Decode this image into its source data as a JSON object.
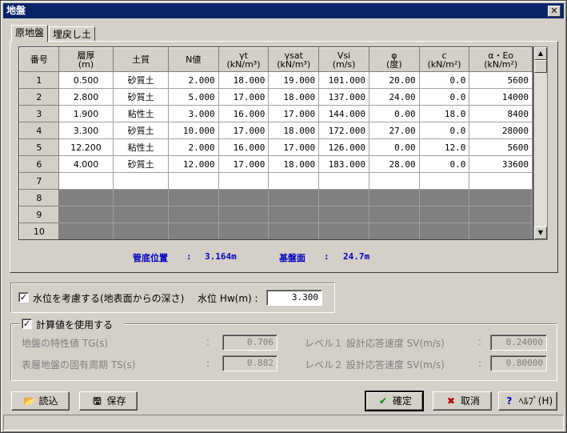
{
  "window": {
    "title": "地盤",
    "close": "✕"
  },
  "tabs": [
    {
      "label": "原地盤"
    },
    {
      "label": "埋戻し土"
    }
  ],
  "table": {
    "headers": [
      "番号",
      "層厚\n(m)",
      "土質",
      "N値",
      "γt\n(kN/m³)",
      "γsat\n(kN/m³)",
      "Vsi\n(m/s)",
      "φ\n(度)",
      "c\n(kN/m²)",
      "α・Eo\n(kN/m²)"
    ],
    "rows": [
      [
        "1",
        "0.500",
        "砂質土",
        "2.000",
        "18.000",
        "19.000",
        "101.000",
        "20.00",
        "0.0",
        "5600"
      ],
      [
        "2",
        "2.800",
        "砂質土",
        "5.000",
        "17.000",
        "18.000",
        "137.000",
        "24.00",
        "0.0",
        "14000"
      ],
      [
        "3",
        "1.900",
        "粘性土",
        "3.000",
        "16.000",
        "17.000",
        "144.000",
        "0.00",
        "18.0",
        "8400"
      ],
      [
        "4",
        "3.300",
        "砂質土",
        "10.000",
        "17.000",
        "18.000",
        "172.000",
        "27.00",
        "0.0",
        "28000"
      ],
      [
        "5",
        "12.200",
        "粘性土",
        "2.000",
        "16.000",
        "17.000",
        "126.000",
        "0.00",
        "12.0",
        "5600"
      ],
      [
        "6",
        "4.000",
        "砂質土",
        "12.000",
        "17.000",
        "18.000",
        "183.000",
        "28.00",
        "0.0",
        "33600"
      ]
    ],
    "empty_rows": [
      "7"
    ],
    "disabled_rows": [
      "8",
      "9",
      "10"
    ]
  },
  "info": {
    "pipe_label": "管底位置",
    "pipe_sep": ":",
    "pipe_value": "3.164m",
    "base_label": "基盤面",
    "base_sep": ":",
    "base_value": "24.7m"
  },
  "water": {
    "checkbox_label": "水位を考慮する(地表面からの深さ)",
    "checked": "✓",
    "level_label": "水位 Hw(m) :",
    "level_value": "3.300"
  },
  "calc": {
    "checkbox_label": "計算値を使用する",
    "checked": "✓",
    "tg_label": "地盤の特性値 TG(s)",
    "tg_sep": ":",
    "tg_value": "0.706",
    "ts_label": "表層地盤の固有周期 TS(s)",
    "ts_sep": ":",
    "ts_value": "0.882",
    "sv1_label": "レベル１ 設計応答速度 SV(m/s)",
    "sv1_sep": ":",
    "sv1_value": "0.24000",
    "sv2_label": "レベル２ 設計応答速度 SV(m/s)",
    "sv2_sep": ":",
    "sv2_value": "0.80000"
  },
  "buttons": {
    "load": "読込",
    "save": "保存",
    "ok": "確定",
    "cancel": "取消",
    "help": "ﾍﾙﾌﾟ(H)"
  },
  "icons": {
    "load": "folder-open-icon",
    "save": "floppy-icon",
    "ok": "check-icon",
    "cancel": "x-icon",
    "help": "question-icon"
  },
  "colors": {
    "title_bg": "#0a246a",
    "info_text": "#0000c0",
    "disabled_row": "#808080",
    "ok_icon": "#008000",
    "cancel_icon": "#c00000",
    "help_icon": "#0000c0"
  }
}
